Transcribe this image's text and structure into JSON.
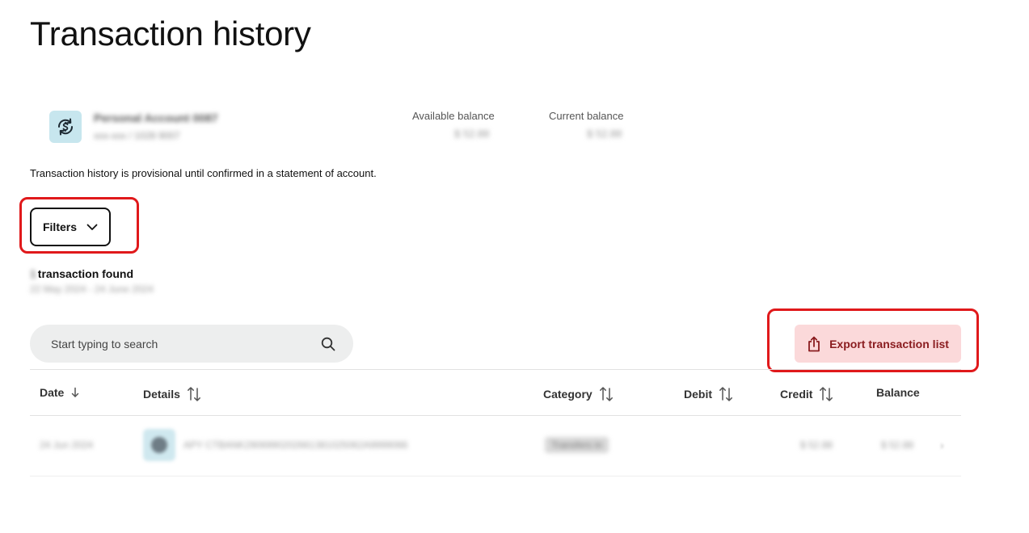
{
  "page": {
    "title": "Transaction history"
  },
  "account": {
    "name": "Personal Account 0087",
    "number": "xxx-xxx / 1028 9007",
    "available_balance_label": "Available balance",
    "available_balance_value": "$ 52.88",
    "current_balance_label": "Current balance",
    "current_balance_value": "$ 52.88"
  },
  "notice": "Transaction history is provisional until confirmed in a statement of account.",
  "filters": {
    "label": "Filters"
  },
  "results": {
    "count": "1",
    "found_label": "transaction found",
    "date_range": "22 May 2024 - 24 June 2024"
  },
  "search": {
    "placeholder": "Start typing to search"
  },
  "export": {
    "label": "Export transaction list"
  },
  "table": {
    "columns": [
      {
        "label": "Date",
        "sort": "descending"
      },
      {
        "label": "Details",
        "sort": "sortable"
      },
      {
        "label": "Category",
        "sort": "sortable"
      },
      {
        "label": "Debit",
        "sort": "sortable"
      },
      {
        "label": "Credit",
        "sort": "sortable"
      },
      {
        "label": "Balance",
        "sort": "none"
      }
    ],
    "rows": [
      {
        "date": "24 Jun 2024",
        "details": "APY CTBANK2906990202661381025062A9999066",
        "category": "Transfers in",
        "debit": "",
        "credit": "$ 52.88",
        "balance": "$ 52.88"
      }
    ]
  },
  "colors": {
    "highlight": "#e0191b",
    "export_bg": "#fbd9da",
    "export_text": "#8a1c1f",
    "account_icon_bg": "#c7e6ee",
    "search_bg": "#edeeee"
  }
}
